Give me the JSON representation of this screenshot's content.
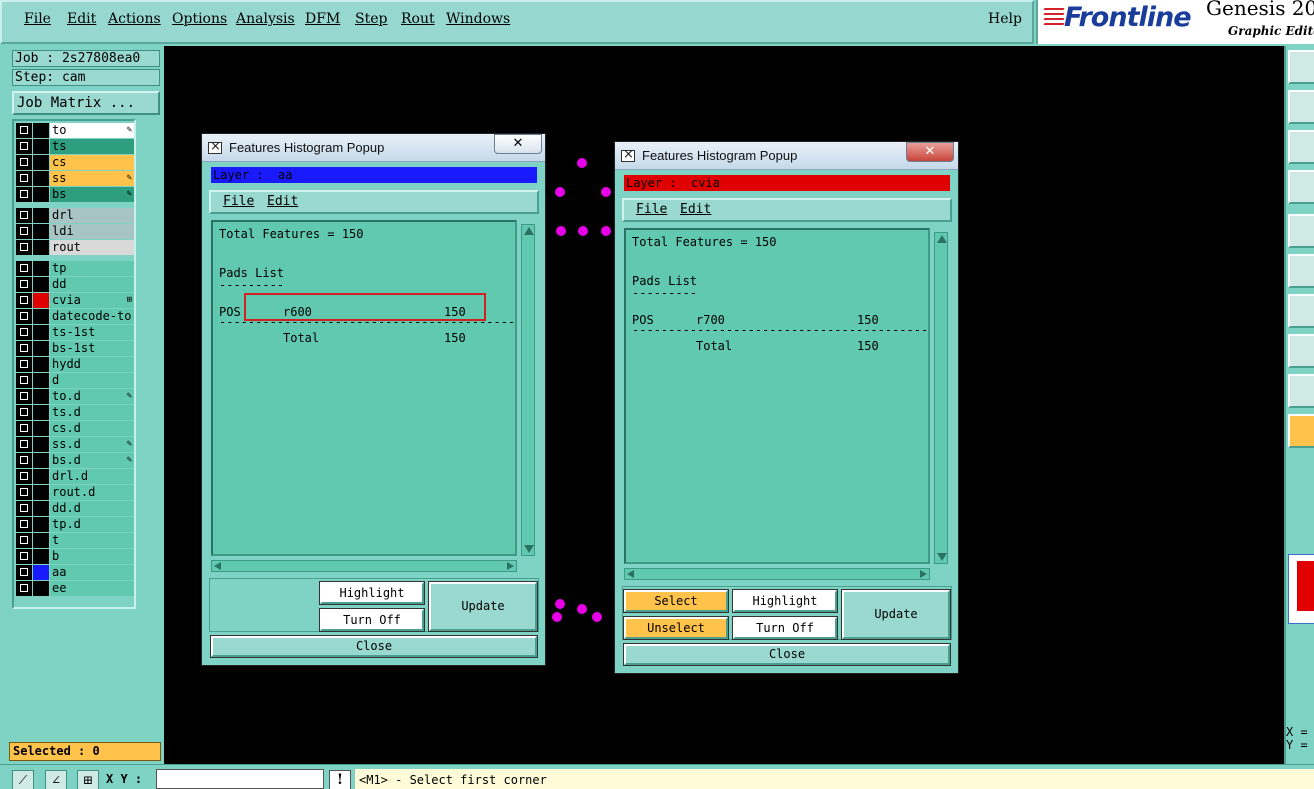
{
  "menubar": {
    "items": [
      "File",
      "Edit",
      "Actions",
      "Options",
      "Analysis",
      "DFM",
      "Step",
      "Rout",
      "Windows"
    ],
    "help": "Help"
  },
  "logo": {
    "brand": "Frontline",
    "product": "Genesis 20",
    "subtitle": "Graphic Editor"
  },
  "left_panel": {
    "job": "Job : 2s27808ea0",
    "step": "Step: cam",
    "job_matrix": "Job Matrix ...",
    "layers": [
      {
        "name": "to",
        "color": "#ffffff",
        "swatch": "#000000",
        "mark": "✎"
      },
      {
        "name": "ts",
        "color": "#2e9e7e",
        "swatch": "#000000",
        "mark": ""
      },
      {
        "name": "cs",
        "color": "#ffc24a",
        "swatch": "#000000",
        "mark": ""
      },
      {
        "name": "ss",
        "color": "#ffc24a",
        "swatch": "#000000",
        "mark": "✎"
      },
      {
        "name": "bs",
        "color": "#2e9e7e",
        "swatch": "#000000",
        "mark": "✎"
      },
      {
        "name": "drl",
        "color": "#a9c4c4",
        "swatch": "#000000",
        "mark": ""
      },
      {
        "name": "ldi",
        "color": "#a9c4c4",
        "swatch": "#000000",
        "mark": ""
      },
      {
        "name": "rout",
        "color": "#d9d9d9",
        "swatch": "#000000",
        "mark": ""
      },
      {
        "name": "tp",
        "color": "#62c9b1",
        "swatch": "#000000",
        "mark": ""
      },
      {
        "name": "dd",
        "color": "#62c9b1",
        "swatch": "#000000",
        "mark": ""
      },
      {
        "name": "cvia",
        "color": "#62c9b1",
        "swatch": "#e00000",
        "mark": "⊞"
      },
      {
        "name": "datecode-to",
        "color": "#62c9b1",
        "swatch": "#000000",
        "mark": ""
      },
      {
        "name": "ts-1st",
        "color": "#62c9b1",
        "swatch": "#000000",
        "mark": ""
      },
      {
        "name": "bs-1st",
        "color": "#62c9b1",
        "swatch": "#000000",
        "mark": ""
      },
      {
        "name": "hydd",
        "color": "#62c9b1",
        "swatch": "#000000",
        "mark": ""
      },
      {
        "name": "d",
        "color": "#62c9b1",
        "swatch": "#000000",
        "mark": ""
      },
      {
        "name": "to.d",
        "color": "#62c9b1",
        "swatch": "#000000",
        "mark": "✎"
      },
      {
        "name": "ts.d",
        "color": "#62c9b1",
        "swatch": "#000000",
        "mark": ""
      },
      {
        "name": "cs.d",
        "color": "#62c9b1",
        "swatch": "#000000",
        "mark": ""
      },
      {
        "name": "ss.d",
        "color": "#62c9b1",
        "swatch": "#000000",
        "mark": "✎"
      },
      {
        "name": "bs.d",
        "color": "#62c9b1",
        "swatch": "#000000",
        "mark": "✎"
      },
      {
        "name": "drl.d",
        "color": "#62c9b1",
        "swatch": "#000000",
        "mark": ""
      },
      {
        "name": "rout.d",
        "color": "#62c9b1",
        "swatch": "#000000",
        "mark": ""
      },
      {
        "name": "dd.d",
        "color": "#62c9b1",
        "swatch": "#000000",
        "mark": ""
      },
      {
        "name": "tp.d",
        "color": "#62c9b1",
        "swatch": "#000000",
        "mark": ""
      },
      {
        "name": "t",
        "color": "#62c9b1",
        "swatch": "#000000",
        "mark": ""
      },
      {
        "name": "b",
        "color": "#62c9b1",
        "swatch": "#000000",
        "mark": ""
      },
      {
        "name": "aa",
        "color": "#62c9b1",
        "swatch": "#1a1aff",
        "mark": ""
      },
      {
        "name": "ee",
        "color": "#62c9b1",
        "swatch": "#000000",
        "mark": ""
      }
    ],
    "selected": "Selected : 0"
  },
  "popup1": {
    "title": "Features Histogram Popup",
    "close_x": "✕",
    "layer_bar": "Layer :  aa",
    "layer_color": "#1a1aff",
    "menu_file": "File",
    "menu_edit": "Edit",
    "total": "Total Features = 150",
    "pads_list": "Pads List",
    "pads_underline": "---------",
    "pos_label": "POS",
    "pad_symbol": "r600",
    "pad_count": "150",
    "divider": "-------------------------------------------",
    "total_label": "Total",
    "total_count": "150",
    "btn_highlight": "Highlight",
    "btn_turnoff": "Turn Off",
    "btn_update": "Update",
    "btn_close": "Close"
  },
  "popup2": {
    "title": "Features Histogram Popup",
    "close_x": "✕",
    "layer_bar": "Layer :  cvia",
    "layer_color": "#e00000",
    "menu_file": "File",
    "menu_edit": "Edit",
    "total": "Total Features = 150",
    "pads_list": "Pads List",
    "pads_underline": "---------",
    "pos_label": "POS",
    "pad_symbol": "r700",
    "pad_count": "150",
    "divider": "-------------------------------------------",
    "total_label": "Total",
    "total_count": "150",
    "btn_select": "Select",
    "btn_unselect": "Unselect",
    "btn_highlight": "Highlight",
    "btn_turnoff": "Turn Off",
    "btn_update": "Update",
    "btn_close": "Close"
  },
  "statusbar": {
    "xy_label": "X Y :",
    "xy_value": "",
    "excl": "!",
    "message": "<M1> - Select first corner"
  },
  "coords": {
    "x_label": "X =",
    "y_label": "Y ="
  }
}
